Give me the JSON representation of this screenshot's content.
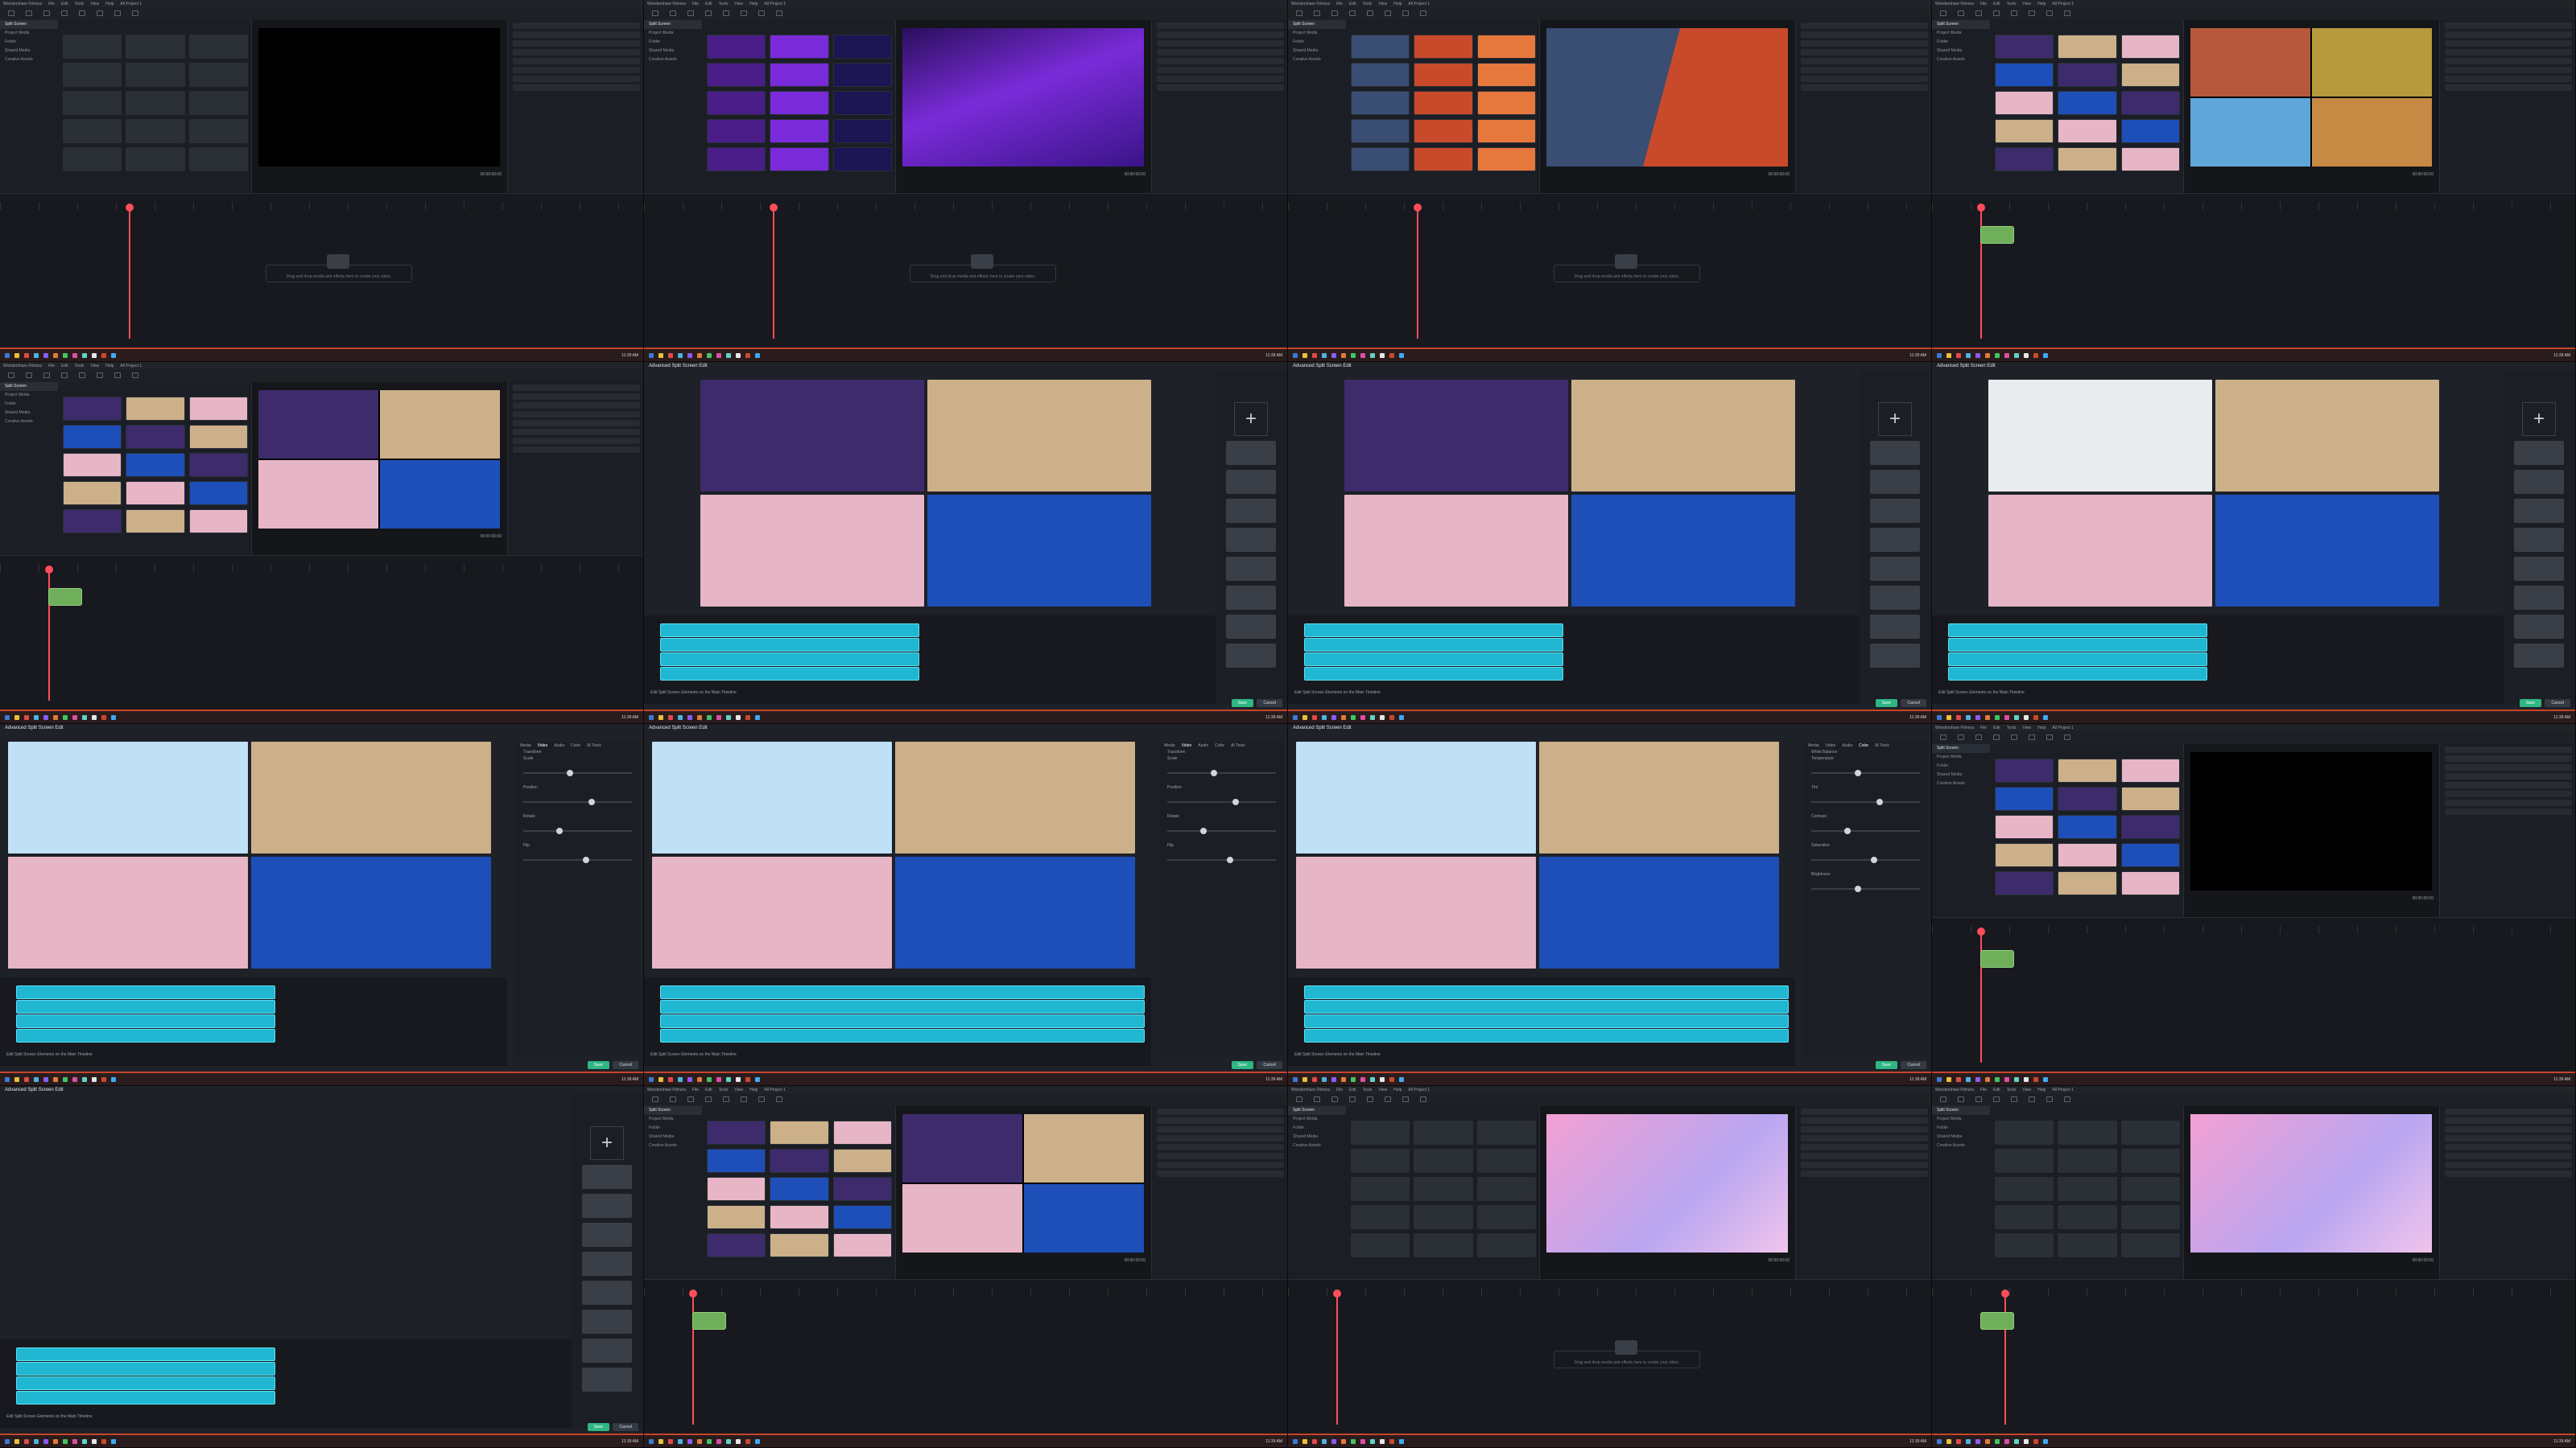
{
  "app": {
    "window_title": "Wondershare Filmora",
    "project_title": "All Project 1",
    "menu": [
      "File",
      "Edit",
      "Tools",
      "View",
      "Help"
    ]
  },
  "toolbar_tabs": [
    "Media",
    "Stock Media",
    "Audio",
    "Titles",
    "Transitions",
    "Effects",
    "Stickers",
    "Templates"
  ],
  "sidebar_items": [
    "Split Screen",
    "Project Media",
    "Folder",
    "Shared Media",
    "Creative Assets"
  ],
  "player": {
    "label": "Player",
    "quality": "Full Quality",
    "timecode": "00:00:00:00"
  },
  "timeline": {
    "drop_hint": "Drag and drop media and effects here to create your video."
  },
  "dialog": {
    "title": "Advanced Split Screen Edit",
    "checkbox": "Edit Split Screen Elements on the Main Timeline",
    "save": "Save",
    "cancel": "Cancel",
    "tabs": [
      "Media",
      "Video",
      "Audio",
      "Color",
      "AI Tools"
    ],
    "section_transform": "Transform",
    "section_compositing": "Compositing",
    "section_white_balance": "White Balance",
    "section_tone": "Tone",
    "labels": [
      "Scale",
      "Position",
      "Rotate",
      "Flip",
      "Temperature",
      "Tint",
      "Contrast",
      "Saturation",
      "Brightness"
    ]
  },
  "taskbar": {
    "clock": "11:39 AM"
  },
  "colors": {
    "accent": "#2fb684",
    "timeline_clip": "#21b6d2",
    "playhead": "#ff4d5a",
    "taskbar_accent": "#c6442b"
  }
}
